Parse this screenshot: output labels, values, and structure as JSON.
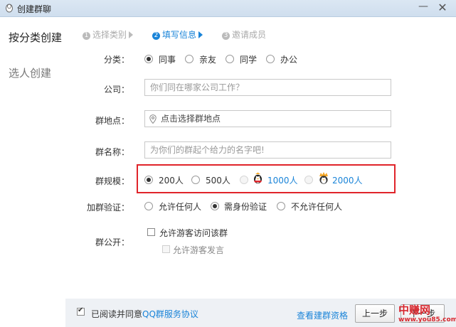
{
  "window": {
    "title": "创建群聊",
    "minimize_glyph": "—",
    "close_glyph": "✕"
  },
  "nav": {
    "by_category": "按分类创建",
    "by_people": "选人创建"
  },
  "steps": [
    {
      "num": "1",
      "label": "选择类别"
    },
    {
      "num": "2",
      "label": "填写信息"
    },
    {
      "num": "3",
      "label": "邀请成员"
    }
  ],
  "form": {
    "category": {
      "label": "分类：",
      "options": [
        "同事",
        "亲友",
        "同学",
        "办公"
      ],
      "selected": "同事"
    },
    "company": {
      "label": "公司：",
      "placeholder": "你们同在哪家公司工作？"
    },
    "location": {
      "label": "群地点：",
      "placeholder": "点击选择群地点"
    },
    "name": {
      "label": "群名称：",
      "placeholder": "为你们的群起个给力的名字吧!"
    },
    "scale": {
      "label": "群规模：",
      "options": [
        "200人",
        "500人",
        "1000人",
        "2000人"
      ],
      "selected": "200人"
    },
    "verify": {
      "label": "加群验证：",
      "options": [
        "允许任何人",
        "需身份验证",
        "不允许任何人"
      ],
      "selected": "需身份验证"
    },
    "public": {
      "label": "群公开：",
      "allow_guest_visit": "允许游客访问该群",
      "allow_guest_speak": "允许游客发言"
    }
  },
  "footer": {
    "agree_prefix": "已阅读并同意",
    "agree_link": "QQ群服务协议",
    "view_link": "查看建群资格",
    "prev_button": "上一步",
    "next_button": "下一步"
  },
  "watermark": {
    "logo": "中赚网",
    "url": "www.you85.com"
  },
  "colors": {
    "accent": "#1a84d8",
    "highlight": "#e0242a",
    "watermark": "#d7282f"
  }
}
